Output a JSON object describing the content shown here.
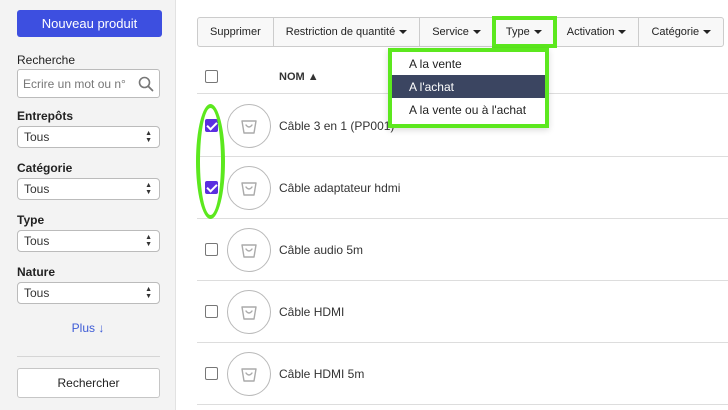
{
  "sidebar": {
    "new_product_label": "Nouveau produit",
    "search_label": "Recherche",
    "search_placeholder": "Ecrire un mot ou n°",
    "filters": [
      {
        "label": "Entrepôts",
        "value": "Tous"
      },
      {
        "label": "Catégorie",
        "value": "Tous"
      },
      {
        "label": "Type",
        "value": "Tous"
      },
      {
        "label": "Nature",
        "value": "Tous"
      }
    ],
    "more_label": "Plus ↓",
    "search_button_label": "Rechercher"
  },
  "toolbar": {
    "delete_label": "Supprimer",
    "quantity_restriction_label": "Restriction de quantité",
    "service_label": "Service",
    "type_label": "Type",
    "activation_label": "Activation",
    "category_label": "Catégorie"
  },
  "type_dropdown": {
    "items": [
      "A la vente",
      "A l'achat",
      "A la vente ou à l'achat"
    ],
    "selected_index": 1
  },
  "table": {
    "column_name": "NOM ▲",
    "rows": [
      {
        "name": "Câble 3 en 1 (PP001)",
        "checked": true
      },
      {
        "name": "Câble adaptateur hdmi",
        "checked": true
      },
      {
        "name": "Câble audio 5m",
        "checked": false
      },
      {
        "name": "Câble HDMI",
        "checked": false
      },
      {
        "name": "Câble HDMI 5m",
        "checked": false
      }
    ]
  },
  "colors": {
    "accent": "#3d4fe0",
    "highlight": "#5ce81e",
    "checkbox_checked": "#5b2fe0",
    "dropdown_selected": "#3b4561"
  }
}
